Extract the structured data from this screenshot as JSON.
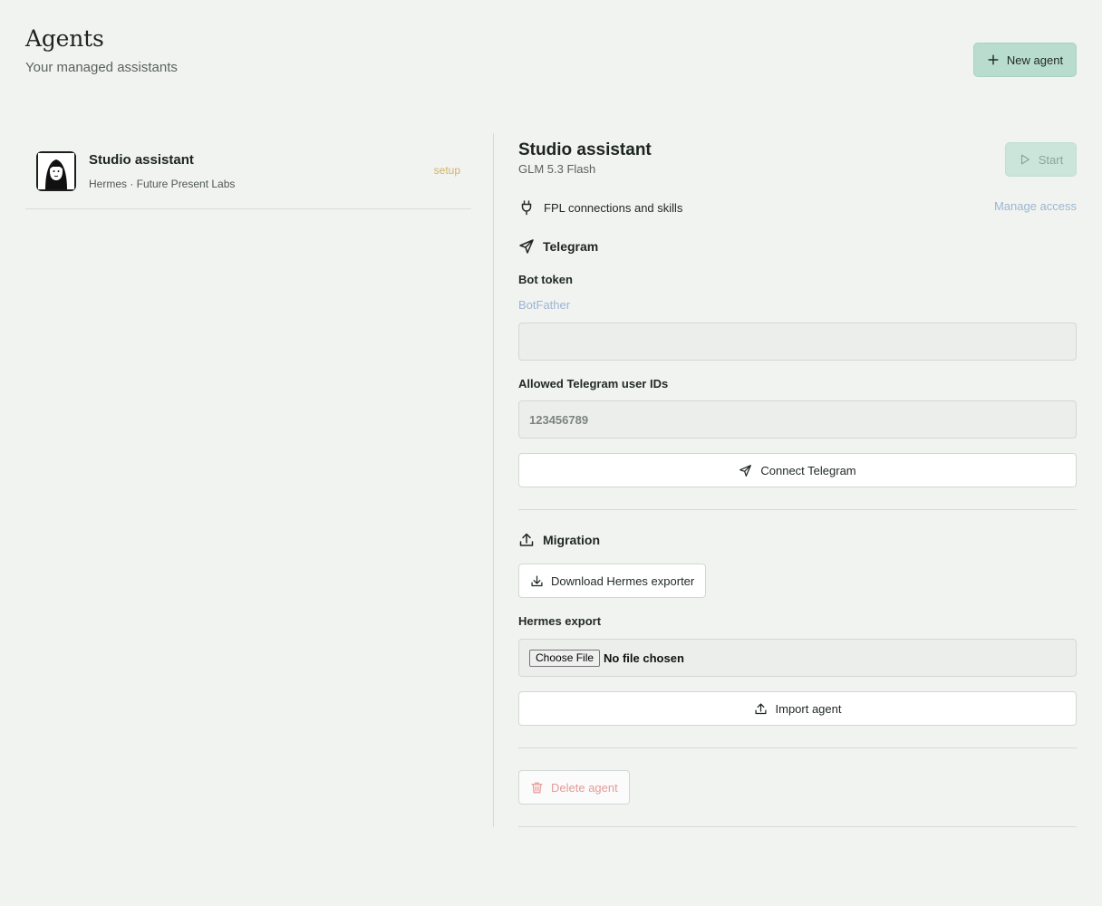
{
  "header": {
    "title": "Agents",
    "subtitle": "Your managed assistants",
    "new_agent_label": "New agent"
  },
  "agents": [
    {
      "name": "Studio assistant",
      "subtitle": "Hermes · Future Present Labs",
      "status": "setup"
    }
  ],
  "detail": {
    "title": "Studio assistant",
    "model": "GLM 5.3 Flash",
    "start_label": "Start",
    "access_label": "FPL connections and skills",
    "manage_access_label": "Manage access",
    "telegram": {
      "heading": "Telegram",
      "bot_token_label": "Bot token",
      "botfather_link": "BotFather",
      "bot_token_value": "",
      "allowed_ids_label": "Allowed Telegram user IDs",
      "allowed_ids_placeholder": "123456789",
      "connect_label": "Connect Telegram"
    },
    "migration": {
      "heading": "Migration",
      "download_label": "Download Hermes exporter",
      "export_label": "Hermes export",
      "choose_file_label": "Choose File",
      "file_status": "No file chosen",
      "import_label": "Import agent"
    },
    "delete_label": "Delete agent"
  },
  "colors": {
    "background": "#f1f3f1",
    "accent": "#b8dccd",
    "link": "#9bb6d3",
    "status_setup": "#d3b26a",
    "danger": "#e69a98"
  },
  "icons": {
    "new_agent": "plus-icon",
    "start": "play-icon",
    "access": "plug-icon",
    "telegram": "send-icon",
    "migration": "upload-icon",
    "download": "download-icon",
    "import": "upload-icon",
    "delete": "trash-icon"
  }
}
